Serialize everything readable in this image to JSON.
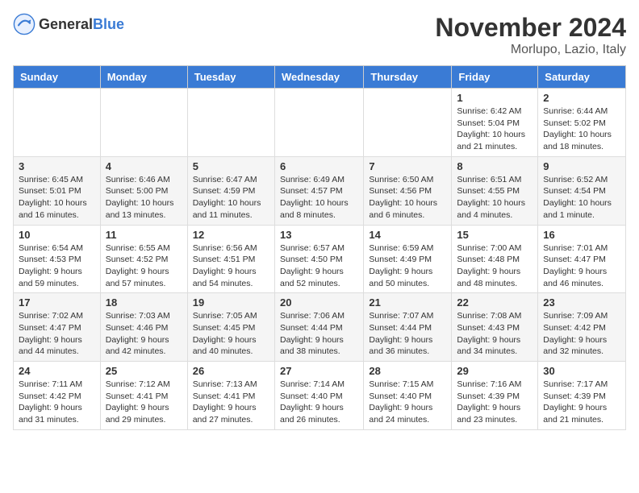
{
  "header": {
    "logo_general": "General",
    "logo_blue": "Blue",
    "month_title": "November 2024",
    "location": "Morlupo, Lazio, Italy"
  },
  "days_of_week": [
    "Sunday",
    "Monday",
    "Tuesday",
    "Wednesday",
    "Thursday",
    "Friday",
    "Saturday"
  ],
  "weeks": [
    [
      {
        "day": "",
        "info": ""
      },
      {
        "day": "",
        "info": ""
      },
      {
        "day": "",
        "info": ""
      },
      {
        "day": "",
        "info": ""
      },
      {
        "day": "",
        "info": ""
      },
      {
        "day": "1",
        "info": "Sunrise: 6:42 AM\nSunset: 5:04 PM\nDaylight: 10 hours and 21 minutes."
      },
      {
        "day": "2",
        "info": "Sunrise: 6:44 AM\nSunset: 5:02 PM\nDaylight: 10 hours and 18 minutes."
      }
    ],
    [
      {
        "day": "3",
        "info": "Sunrise: 6:45 AM\nSunset: 5:01 PM\nDaylight: 10 hours and 16 minutes."
      },
      {
        "day": "4",
        "info": "Sunrise: 6:46 AM\nSunset: 5:00 PM\nDaylight: 10 hours and 13 minutes."
      },
      {
        "day": "5",
        "info": "Sunrise: 6:47 AM\nSunset: 4:59 PM\nDaylight: 10 hours and 11 minutes."
      },
      {
        "day": "6",
        "info": "Sunrise: 6:49 AM\nSunset: 4:57 PM\nDaylight: 10 hours and 8 minutes."
      },
      {
        "day": "7",
        "info": "Sunrise: 6:50 AM\nSunset: 4:56 PM\nDaylight: 10 hours and 6 minutes."
      },
      {
        "day": "8",
        "info": "Sunrise: 6:51 AM\nSunset: 4:55 PM\nDaylight: 10 hours and 4 minutes."
      },
      {
        "day": "9",
        "info": "Sunrise: 6:52 AM\nSunset: 4:54 PM\nDaylight: 10 hours and 1 minute."
      }
    ],
    [
      {
        "day": "10",
        "info": "Sunrise: 6:54 AM\nSunset: 4:53 PM\nDaylight: 9 hours and 59 minutes."
      },
      {
        "day": "11",
        "info": "Sunrise: 6:55 AM\nSunset: 4:52 PM\nDaylight: 9 hours and 57 minutes."
      },
      {
        "day": "12",
        "info": "Sunrise: 6:56 AM\nSunset: 4:51 PM\nDaylight: 9 hours and 54 minutes."
      },
      {
        "day": "13",
        "info": "Sunrise: 6:57 AM\nSunset: 4:50 PM\nDaylight: 9 hours and 52 minutes."
      },
      {
        "day": "14",
        "info": "Sunrise: 6:59 AM\nSunset: 4:49 PM\nDaylight: 9 hours and 50 minutes."
      },
      {
        "day": "15",
        "info": "Sunrise: 7:00 AM\nSunset: 4:48 PM\nDaylight: 9 hours and 48 minutes."
      },
      {
        "day": "16",
        "info": "Sunrise: 7:01 AM\nSunset: 4:47 PM\nDaylight: 9 hours and 46 minutes."
      }
    ],
    [
      {
        "day": "17",
        "info": "Sunrise: 7:02 AM\nSunset: 4:47 PM\nDaylight: 9 hours and 44 minutes."
      },
      {
        "day": "18",
        "info": "Sunrise: 7:03 AM\nSunset: 4:46 PM\nDaylight: 9 hours and 42 minutes."
      },
      {
        "day": "19",
        "info": "Sunrise: 7:05 AM\nSunset: 4:45 PM\nDaylight: 9 hours and 40 minutes."
      },
      {
        "day": "20",
        "info": "Sunrise: 7:06 AM\nSunset: 4:44 PM\nDaylight: 9 hours and 38 minutes."
      },
      {
        "day": "21",
        "info": "Sunrise: 7:07 AM\nSunset: 4:44 PM\nDaylight: 9 hours and 36 minutes."
      },
      {
        "day": "22",
        "info": "Sunrise: 7:08 AM\nSunset: 4:43 PM\nDaylight: 9 hours and 34 minutes."
      },
      {
        "day": "23",
        "info": "Sunrise: 7:09 AM\nSunset: 4:42 PM\nDaylight: 9 hours and 32 minutes."
      }
    ],
    [
      {
        "day": "24",
        "info": "Sunrise: 7:11 AM\nSunset: 4:42 PM\nDaylight: 9 hours and 31 minutes."
      },
      {
        "day": "25",
        "info": "Sunrise: 7:12 AM\nSunset: 4:41 PM\nDaylight: 9 hours and 29 minutes."
      },
      {
        "day": "26",
        "info": "Sunrise: 7:13 AM\nSunset: 4:41 PM\nDaylight: 9 hours and 27 minutes."
      },
      {
        "day": "27",
        "info": "Sunrise: 7:14 AM\nSunset: 4:40 PM\nDaylight: 9 hours and 26 minutes."
      },
      {
        "day": "28",
        "info": "Sunrise: 7:15 AM\nSunset: 4:40 PM\nDaylight: 9 hours and 24 minutes."
      },
      {
        "day": "29",
        "info": "Sunrise: 7:16 AM\nSunset: 4:39 PM\nDaylight: 9 hours and 23 minutes."
      },
      {
        "day": "30",
        "info": "Sunrise: 7:17 AM\nSunset: 4:39 PM\nDaylight: 9 hours and 21 minutes."
      }
    ]
  ]
}
